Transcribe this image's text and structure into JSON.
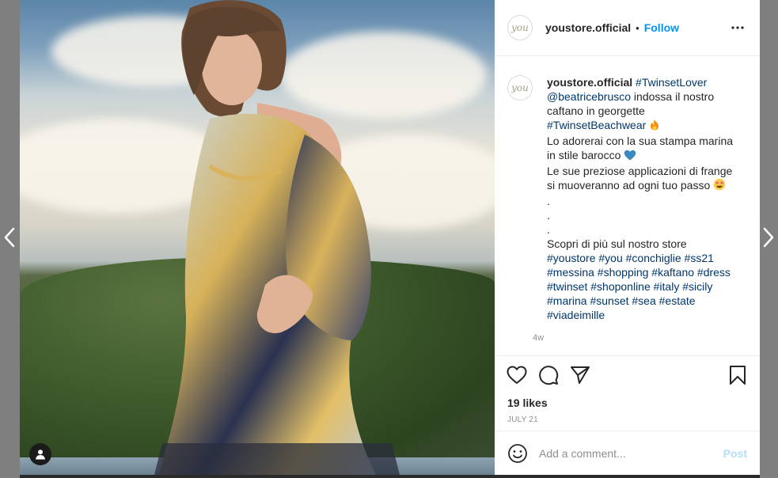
{
  "post": {
    "username": "youstore.official",
    "avatar_text": "you",
    "follow_label": "Follow",
    "separator": "•",
    "caption_lines": [
      [
        {
          "t": "youstore.official",
          "k": "uname"
        },
        {
          "t": " "
        },
        {
          "t": "#TwinsetLover",
          "k": "link"
        }
      ],
      [
        {
          "t": "@beatricebrusco",
          "k": "link"
        },
        {
          "t": " indossa il nostro"
        }
      ],
      [
        {
          "t": "caftano in georgette"
        }
      ],
      [
        {
          "t": "#TwinsetBeachwear",
          "k": "link"
        },
        {
          "e": "fire-emoji"
        }
      ],
      [
        {
          "t": "Lo adorerai con la sua stampa marina"
        }
      ],
      [
        {
          "t": "in stile barocco"
        },
        {
          "e": "blue-heart-emoji"
        }
      ],
      [
        {
          "t": "Le sue preziose applicazioni di frange"
        }
      ],
      [
        {
          "t": "si muoveranno ad ogni tuo passo"
        },
        {
          "e": "star-struck-emoji"
        }
      ],
      [
        {
          "t": "."
        }
      ],
      [
        {
          "t": "."
        }
      ],
      [
        {
          "t": "."
        }
      ],
      [
        {
          "t": "Scopri di più sul nostro store"
        }
      ],
      [
        {
          "t": "#youstore #you #conchiglie #ss21",
          "k": "link"
        }
      ],
      [
        {
          "t": "#messina #shopping #kaftano #dress",
          "k": "link"
        }
      ],
      [
        {
          "t": "#twinset #shoponline #italy #sicily",
          "k": "link"
        }
      ],
      [
        {
          "t": "#marina #sunset #sea #estate",
          "k": "link"
        }
      ],
      [
        {
          "t": "#viadeimille",
          "k": "link"
        }
      ]
    ],
    "time_ago": "4w",
    "likes": "19 likes",
    "date": "JULY 21"
  },
  "comment": {
    "placeholder": "Add a comment...",
    "post_label": "Post"
  },
  "icons": {
    "nav_left": "chevron-left-icon",
    "nav_right": "chevron-right-icon",
    "more": "more-options-icon",
    "like": "heart-icon",
    "comment": "comment-icon",
    "share": "share-icon",
    "save": "bookmark-icon",
    "emoji": "smile-icon",
    "tag": "user-tag-icon"
  },
  "colors": {
    "link": "#00376b",
    "follow": "#0095f6",
    "post_disabled": "#b2dffc",
    "muted": "#8e8e8e",
    "backdrop": "#7f7f7f"
  }
}
